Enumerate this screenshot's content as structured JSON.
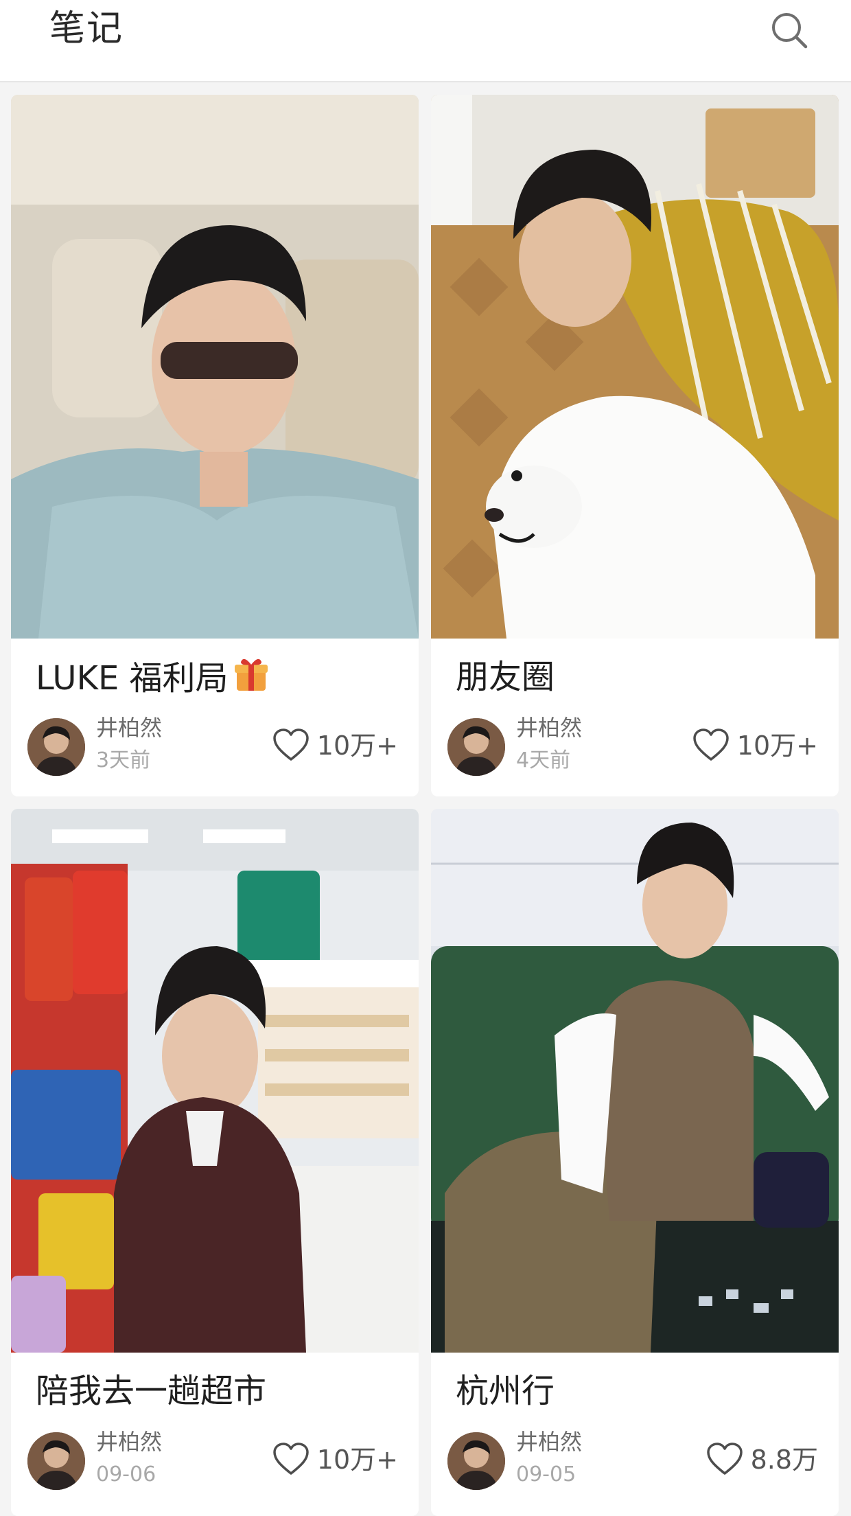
{
  "header": {
    "title": "笔记",
    "search_icon": "search-icon"
  },
  "notes": [
    {
      "title": "LUKE 福利局",
      "title_emoji": "gift-icon",
      "author": "井柏然",
      "date": "3天前",
      "likes": "10万+"
    },
    {
      "title": "朋友圈",
      "author": "井柏然",
      "date": "4天前",
      "likes": "10万+"
    },
    {
      "title": "陪我去一趟超市",
      "author": "井柏然",
      "date": "09-06",
      "likes": "10万+"
    },
    {
      "title": "杭州行",
      "author": "井柏然",
      "date": "09-05",
      "likes": "8.8万"
    }
  ],
  "colors": {
    "header_bg": "#ffffff",
    "page_bg": "#f4f4f4",
    "card_bg": "#ffffff",
    "title_text": "#1f1f1f",
    "meta_text": "#a8a8a8"
  }
}
